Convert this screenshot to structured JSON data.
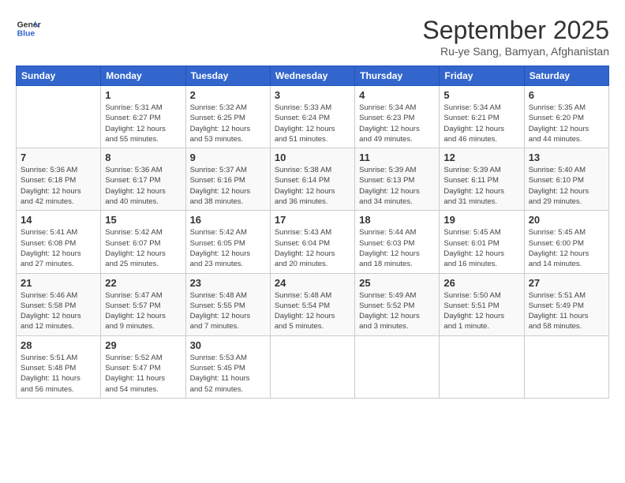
{
  "header": {
    "logo_line1": "General",
    "logo_line2": "Blue",
    "month_title": "September 2025",
    "subtitle": "Ru-ye Sang, Bamyan, Afghanistan"
  },
  "weekdays": [
    "Sunday",
    "Monday",
    "Tuesday",
    "Wednesday",
    "Thursday",
    "Friday",
    "Saturday"
  ],
  "weeks": [
    [
      {
        "day": "",
        "info": ""
      },
      {
        "day": "1",
        "info": "Sunrise: 5:31 AM\nSunset: 6:27 PM\nDaylight: 12 hours\nand 55 minutes."
      },
      {
        "day": "2",
        "info": "Sunrise: 5:32 AM\nSunset: 6:25 PM\nDaylight: 12 hours\nand 53 minutes."
      },
      {
        "day": "3",
        "info": "Sunrise: 5:33 AM\nSunset: 6:24 PM\nDaylight: 12 hours\nand 51 minutes."
      },
      {
        "day": "4",
        "info": "Sunrise: 5:34 AM\nSunset: 6:23 PM\nDaylight: 12 hours\nand 49 minutes."
      },
      {
        "day": "5",
        "info": "Sunrise: 5:34 AM\nSunset: 6:21 PM\nDaylight: 12 hours\nand 46 minutes."
      },
      {
        "day": "6",
        "info": "Sunrise: 5:35 AM\nSunset: 6:20 PM\nDaylight: 12 hours\nand 44 minutes."
      }
    ],
    [
      {
        "day": "7",
        "info": "Sunrise: 5:36 AM\nSunset: 6:18 PM\nDaylight: 12 hours\nand 42 minutes."
      },
      {
        "day": "8",
        "info": "Sunrise: 5:36 AM\nSunset: 6:17 PM\nDaylight: 12 hours\nand 40 minutes."
      },
      {
        "day": "9",
        "info": "Sunrise: 5:37 AM\nSunset: 6:16 PM\nDaylight: 12 hours\nand 38 minutes."
      },
      {
        "day": "10",
        "info": "Sunrise: 5:38 AM\nSunset: 6:14 PM\nDaylight: 12 hours\nand 36 minutes."
      },
      {
        "day": "11",
        "info": "Sunrise: 5:39 AM\nSunset: 6:13 PM\nDaylight: 12 hours\nand 34 minutes."
      },
      {
        "day": "12",
        "info": "Sunrise: 5:39 AM\nSunset: 6:11 PM\nDaylight: 12 hours\nand 31 minutes."
      },
      {
        "day": "13",
        "info": "Sunrise: 5:40 AM\nSunset: 6:10 PM\nDaylight: 12 hours\nand 29 minutes."
      }
    ],
    [
      {
        "day": "14",
        "info": "Sunrise: 5:41 AM\nSunset: 6:08 PM\nDaylight: 12 hours\nand 27 minutes."
      },
      {
        "day": "15",
        "info": "Sunrise: 5:42 AM\nSunset: 6:07 PM\nDaylight: 12 hours\nand 25 minutes."
      },
      {
        "day": "16",
        "info": "Sunrise: 5:42 AM\nSunset: 6:05 PM\nDaylight: 12 hours\nand 23 minutes."
      },
      {
        "day": "17",
        "info": "Sunrise: 5:43 AM\nSunset: 6:04 PM\nDaylight: 12 hours\nand 20 minutes."
      },
      {
        "day": "18",
        "info": "Sunrise: 5:44 AM\nSunset: 6:03 PM\nDaylight: 12 hours\nand 18 minutes."
      },
      {
        "day": "19",
        "info": "Sunrise: 5:45 AM\nSunset: 6:01 PM\nDaylight: 12 hours\nand 16 minutes."
      },
      {
        "day": "20",
        "info": "Sunrise: 5:45 AM\nSunset: 6:00 PM\nDaylight: 12 hours\nand 14 minutes."
      }
    ],
    [
      {
        "day": "21",
        "info": "Sunrise: 5:46 AM\nSunset: 5:58 PM\nDaylight: 12 hours\nand 12 minutes."
      },
      {
        "day": "22",
        "info": "Sunrise: 5:47 AM\nSunset: 5:57 PM\nDaylight: 12 hours\nand 9 minutes."
      },
      {
        "day": "23",
        "info": "Sunrise: 5:48 AM\nSunset: 5:55 PM\nDaylight: 12 hours\nand 7 minutes."
      },
      {
        "day": "24",
        "info": "Sunrise: 5:48 AM\nSunset: 5:54 PM\nDaylight: 12 hours\nand 5 minutes."
      },
      {
        "day": "25",
        "info": "Sunrise: 5:49 AM\nSunset: 5:52 PM\nDaylight: 12 hours\nand 3 minutes."
      },
      {
        "day": "26",
        "info": "Sunrise: 5:50 AM\nSunset: 5:51 PM\nDaylight: 12 hours\nand 1 minute."
      },
      {
        "day": "27",
        "info": "Sunrise: 5:51 AM\nSunset: 5:49 PM\nDaylight: 11 hours\nand 58 minutes."
      }
    ],
    [
      {
        "day": "28",
        "info": "Sunrise: 5:51 AM\nSunset: 5:48 PM\nDaylight: 11 hours\nand 56 minutes."
      },
      {
        "day": "29",
        "info": "Sunrise: 5:52 AM\nSunset: 5:47 PM\nDaylight: 11 hours\nand 54 minutes."
      },
      {
        "day": "30",
        "info": "Sunrise: 5:53 AM\nSunset: 5:45 PM\nDaylight: 11 hours\nand 52 minutes."
      },
      {
        "day": "",
        "info": ""
      },
      {
        "day": "",
        "info": ""
      },
      {
        "day": "",
        "info": ""
      },
      {
        "day": "",
        "info": ""
      }
    ]
  ]
}
